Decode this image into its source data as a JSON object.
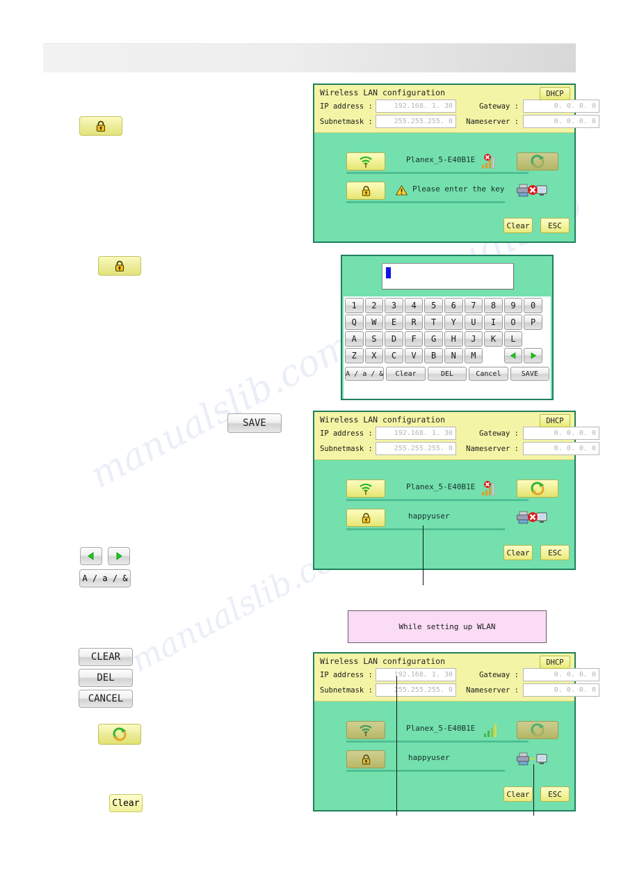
{
  "document": {
    "title": "Wireless LAN configuration manual page",
    "watermarks": [
      "manualslib.com",
      "manualslib.com",
      "manualslib"
    ]
  },
  "left_buttons": [
    {
      "name": "lock-button-1",
      "icon": "lock-icon",
      "label": ""
    },
    {
      "name": "lock-button-2",
      "icon": "lock-icon",
      "label": ""
    },
    {
      "name": "save-button",
      "icon": "",
      "label": "SAVE"
    },
    {
      "name": "arrow-left-button",
      "icon": "arrow-left-icon",
      "label": ""
    },
    {
      "name": "arrow-right-button",
      "icon": "arrow-right-icon",
      "label": ""
    },
    {
      "name": "case-toggle-button",
      "icon": "",
      "label": "A / a / &"
    },
    {
      "name": "clear-button-caps",
      "icon": "",
      "label": "CLEAR"
    },
    {
      "name": "del-button",
      "icon": "",
      "label": "DEL"
    },
    {
      "name": "cancel-button",
      "icon": "",
      "label": "CANCEL"
    },
    {
      "name": "refresh-button",
      "icon": "refresh-icon",
      "label": ""
    },
    {
      "name": "clear-button",
      "icon": "",
      "label": "Clear"
    }
  ],
  "panel1": {
    "title": "Wireless LAN configuration",
    "dhcp_label": "DHCP",
    "fields": [
      {
        "label": "IP address :",
        "value": "192.168.  1. 30"
      },
      {
        "label": "Gateway :",
        "value": "0.  0.  0.  0"
      },
      {
        "label": "Subnetmask :",
        "value": "255.255.255.  0"
      },
      {
        "label": "Nameserver :",
        "value": "0.  0.  0.  0"
      }
    ],
    "ssid_row": {
      "icon": "wifi-icon",
      "text": "Planex_5-E40B1E",
      "signal_icon": "signal-bars-error-icon",
      "refresh_icon": "refresh-icon",
      "refresh_enabled": false
    },
    "key_row": {
      "icon": "lock-icon",
      "warning_icon": "warning-triangle-icon",
      "text": "Please enter the key",
      "status_icon": "printer-disconnected-icon"
    },
    "clear_label": "Clear",
    "esc_label": "ESC"
  },
  "keyboard": {
    "input_value": "",
    "rows": [
      [
        "1",
        "2",
        "3",
        "4",
        "5",
        "6",
        "7",
        "8",
        "9",
        "0"
      ],
      [
        "Q",
        "W",
        "E",
        "R",
        "T",
        "Y",
        "U",
        "I",
        "O",
        "P"
      ],
      [
        "A",
        "S",
        "D",
        "F",
        "G",
        "H",
        "J",
        "K",
        "L",
        ""
      ],
      [
        "Z",
        "X",
        "C",
        "V",
        "B",
        "N",
        "M",
        "",
        "◀",
        "▶"
      ]
    ],
    "function_keys": [
      "A / a / &",
      "Clear",
      "DEL",
      "Cancel",
      "SAVE"
    ]
  },
  "panel2": {
    "title": "Wireless LAN configuration",
    "dhcp_label": "DHCP",
    "fields": [
      {
        "label": "IP address :",
        "value": "192.168.  1. 30"
      },
      {
        "label": "Gateway :",
        "value": "0.  0.  0.  0"
      },
      {
        "label": "Subnetmask :",
        "value": "255.255.255.  0"
      },
      {
        "label": "Nameserver :",
        "value": "0.  0.  0.  0"
      }
    ],
    "ssid_row": {
      "icon": "wifi-icon",
      "text": "Planex_5-E40B1E",
      "signal_icon": "signal-bars-error-icon",
      "refresh_icon": "refresh-icon",
      "refresh_enabled": true
    },
    "key_row": {
      "icon": "lock-icon",
      "text": "happyuser",
      "status_icon": "printer-disconnected-icon"
    },
    "clear_label": "Clear",
    "esc_label": "ESC"
  },
  "notice": {
    "text": "While setting up WLAN"
  },
  "panel3": {
    "title": "Wireless LAN configuration",
    "dhcp_label": "DHCP",
    "fields": [
      {
        "label": "IP address :",
        "value": "192.168.  1. 30"
      },
      {
        "label": "Gateway :",
        "value": "0.  0.  0.  0"
      },
      {
        "label": "Subnetmask :",
        "value": "255.255.255.  0"
      },
      {
        "label": "Nameserver :",
        "value": "0.  0.  0.  0"
      }
    ],
    "ssid_row": {
      "icon": "wifi-icon",
      "text": "Planex_5-E40B1E",
      "signal_icon": "signal-bars-ok-icon",
      "refresh_icon": "refresh-icon",
      "refresh_enabled": false
    },
    "key_row": {
      "icon": "lock-icon",
      "text": "happyuser",
      "status_icon": "printer-connected-icon"
    },
    "clear_label": "Clear",
    "esc_label": "ESC"
  },
  "colors": {
    "panel_body": "#73e0ae",
    "panel_head": "#f4f4a6",
    "panel_border": "#1f7f5c",
    "button_yellow": "#eaea7e",
    "notice_pink": "#fadcf5",
    "caret_blue": "#1313e8"
  }
}
